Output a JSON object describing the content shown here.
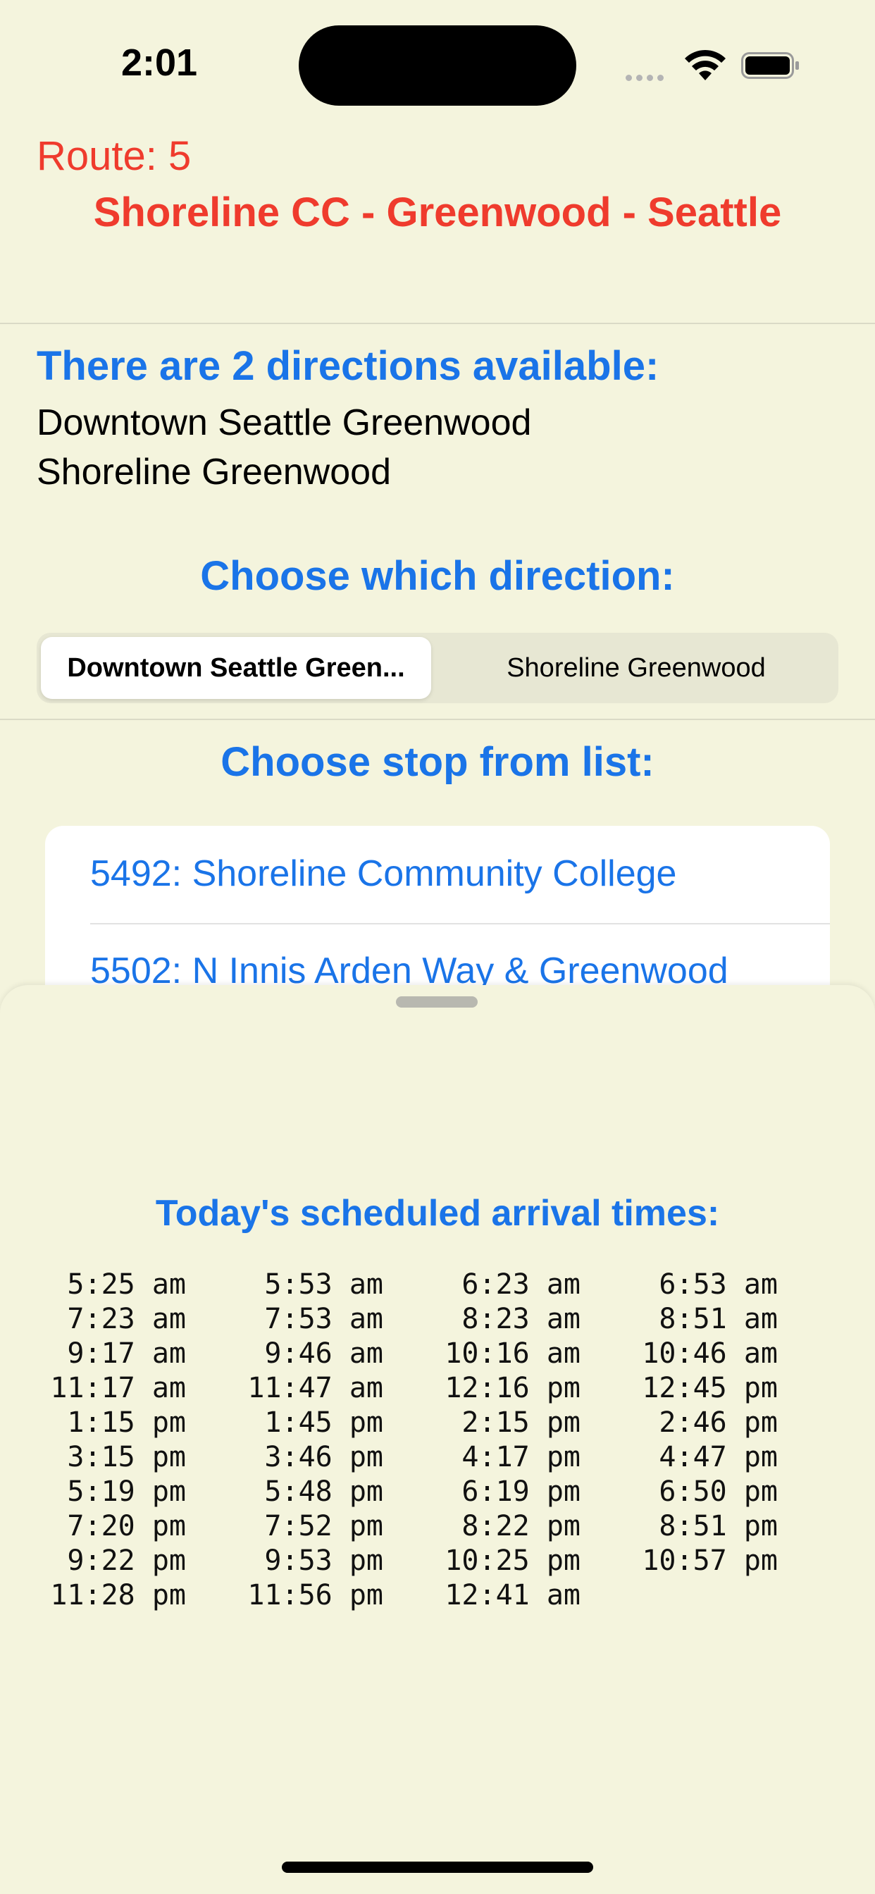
{
  "status_bar": {
    "time": "2:01"
  },
  "route": {
    "title": "Route: 5",
    "name": "Shoreline CC - Greenwood - Seattle"
  },
  "directions": {
    "heading": "There are 2 directions available:",
    "items": [
      "Downtown Seattle Greenwood",
      "Shoreline Greenwood"
    ]
  },
  "choose_direction": {
    "heading": "Choose which direction:",
    "segments": [
      "Downtown Seattle Green...",
      "Shoreline Greenwood"
    ],
    "selected": "Downtown Seattle Green..."
  },
  "stops": {
    "heading": "Choose stop from list:",
    "items": [
      "5492: Shoreline Community College",
      "5502: N Innis Arden Way & Greenwood"
    ]
  },
  "arrivals": {
    "heading": "Today's scheduled arrival times:",
    "rows": [
      [
        "5:25 am",
        "5:53 am",
        "6:23 am",
        "6:53 am"
      ],
      [
        "7:23 am",
        "7:53 am",
        "8:23 am",
        "8:51 am"
      ],
      [
        "9:17 am",
        "9:46 am",
        "10:16 am",
        "10:46 am"
      ],
      [
        "11:17 am",
        "11:47 am",
        "12:16 pm",
        "12:45 pm"
      ],
      [
        "1:15 pm",
        "1:45 pm",
        "2:15 pm",
        "2:46 pm"
      ],
      [
        "3:15 pm",
        "3:46 pm",
        "4:17 pm",
        "4:47 pm"
      ],
      [
        "5:19 pm",
        "5:48 pm",
        "6:19 pm",
        "6:50 pm"
      ],
      [
        "7:20 pm",
        "7:52 pm",
        "8:22 pm",
        "8:51 pm"
      ],
      [
        "9:22 pm",
        "9:53 pm",
        "10:25 pm",
        "10:57 pm"
      ],
      [
        "11:28 pm",
        "11:56 pm",
        "12:41 am",
        ""
      ]
    ]
  },
  "colors": {
    "background": "#F4F4DD",
    "accent_blue": "#1A74E8",
    "route_red": "#EF3B2D"
  }
}
